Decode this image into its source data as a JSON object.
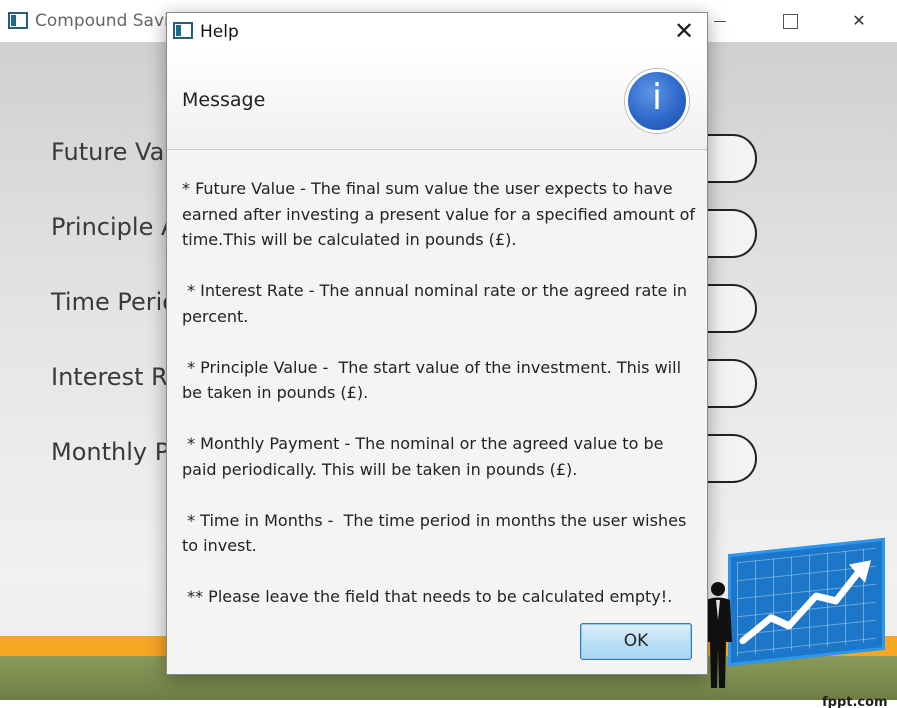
{
  "main_window": {
    "title": "Compound Savi",
    "close_glyph": "✕",
    "form_labels": [
      "Future Val",
      "Principle A",
      "Time Perio",
      "Interest Ra",
      "Monthly P"
    ],
    "footer_text": "fppt.com",
    "colors": {
      "orange_stripe": "#f5a623",
      "olive_stripe": "#7b8b4d",
      "board_blue": "#1c76c9"
    }
  },
  "dialog": {
    "title": "Help",
    "close_glyph": "✕",
    "header_text": "Message",
    "info_icon_glyph": "i",
    "paragraphs": [
      "* Future Value - The final sum value the user expects to have earned after investing a present value for a specified amount of time.This will be calculated in pounds (£).",
      " * Interest Rate - The annual nominal rate or the agreed rate in percent.",
      " * Principle Value -  The start value of the investment. This will be taken in pounds (£).",
      " * Monthly Payment - The nominal or the agreed value to be paid periodically. This will be taken in pounds (£).",
      " * Time in Months -  The time period in months the user wishes to invest.",
      " ** Please leave the field that needs to be calculated empty!."
    ],
    "ok_label": "OK",
    "colors": {
      "info_blue": "#2f68c8",
      "ok_border": "#2f7bbd"
    }
  }
}
